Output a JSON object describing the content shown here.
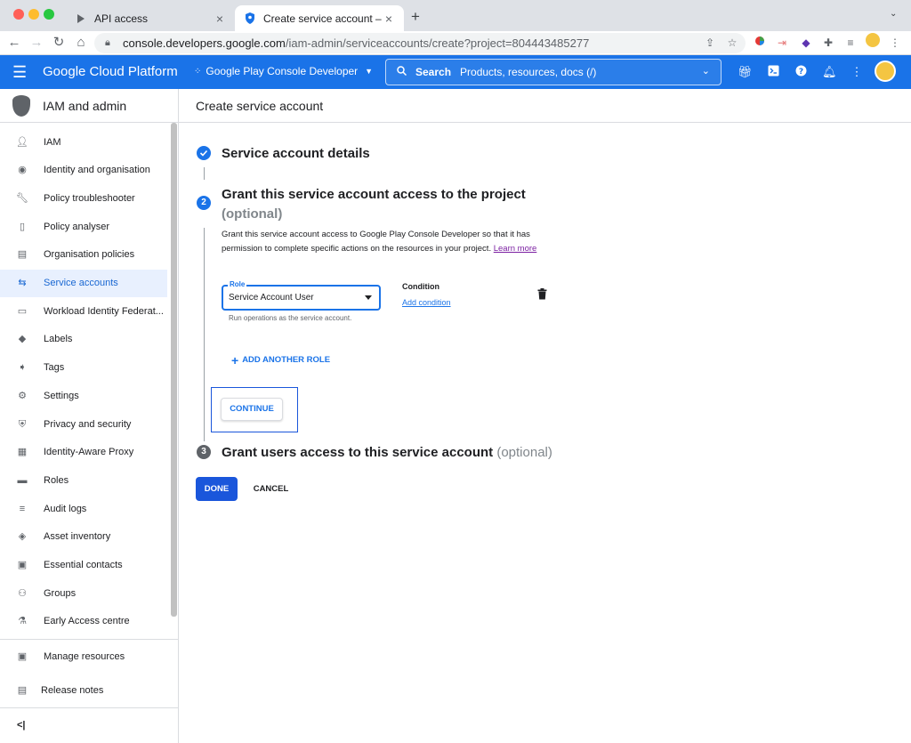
{
  "browser": {
    "tabs": [
      {
        "title": "API access",
        "active": false
      },
      {
        "title": "Create service account – IAM a",
        "active": true
      }
    ],
    "url_host": "console.developers.google.com",
    "url_path": "/iam-admin/serviceaccounts/create?project=804443485277"
  },
  "header": {
    "brand": "Google Cloud Platform",
    "project": "Google Play Console Developer",
    "search_label": "Search",
    "search_placeholder": "Products, resources, docs (/)"
  },
  "sidebar": {
    "title": "IAM and admin",
    "items": [
      {
        "label": "IAM",
        "icon": "person-add-icon"
      },
      {
        "label": "Identity and organisation",
        "icon": "account-circle-icon"
      },
      {
        "label": "Policy troubleshooter",
        "icon": "wrench-icon"
      },
      {
        "label": "Policy analyser",
        "icon": "document-search-icon"
      },
      {
        "label": "Organisation policies",
        "icon": "list-box-icon"
      },
      {
        "label": "Service accounts",
        "icon": "service-account-icon",
        "active": true
      },
      {
        "label": "Workload Identity Federat...",
        "icon": "id-card-icon"
      },
      {
        "label": "Labels",
        "icon": "label-icon"
      },
      {
        "label": "Tags",
        "icon": "tag-arrow-icon"
      },
      {
        "label": "Settings",
        "icon": "gear-icon"
      },
      {
        "label": "Privacy and security",
        "icon": "shield-icon"
      },
      {
        "label": "Identity-Aware Proxy",
        "icon": "proxy-icon"
      },
      {
        "label": "Roles",
        "icon": "hat-icon"
      },
      {
        "label": "Audit logs",
        "icon": "lines-icon"
      },
      {
        "label": "Asset inventory",
        "icon": "eye-diamond-icon"
      },
      {
        "label": "Essential contacts",
        "icon": "contacts-icon"
      },
      {
        "label": "Groups",
        "icon": "people-icon"
      },
      {
        "label": "Early Access centre",
        "icon": "flask-icon"
      }
    ],
    "manage_resources": "Manage resources",
    "release_notes": "Release notes",
    "collapse": "<|"
  },
  "main": {
    "page_title": "Create service account",
    "step1": {
      "title": "Service account details"
    },
    "step2": {
      "number": "2",
      "title": "Grant this service account access to the project",
      "optional": "(optional)",
      "description": "Grant this service account access to Google Play Console Developer so that it has permission to complete specific actions on the resources in your project.",
      "learn_more": "Learn more",
      "role_label": "Role",
      "role_value": "Service Account User",
      "role_helper": "Run operations as the service account.",
      "condition_label": "Condition",
      "add_condition": "Add condition",
      "add_another_role": "ADD ANOTHER ROLE",
      "continue": "CONTINUE"
    },
    "step3": {
      "number": "3",
      "title": "Grant users access to this service account",
      "optional": "(optional)"
    },
    "done": "DONE",
    "cancel": "CANCEL"
  },
  "colors": {
    "accent": "#1a73e8",
    "header_bg": "#1a73e8",
    "active_bg": "#e8f0fe",
    "done_button": "#1a56db"
  }
}
